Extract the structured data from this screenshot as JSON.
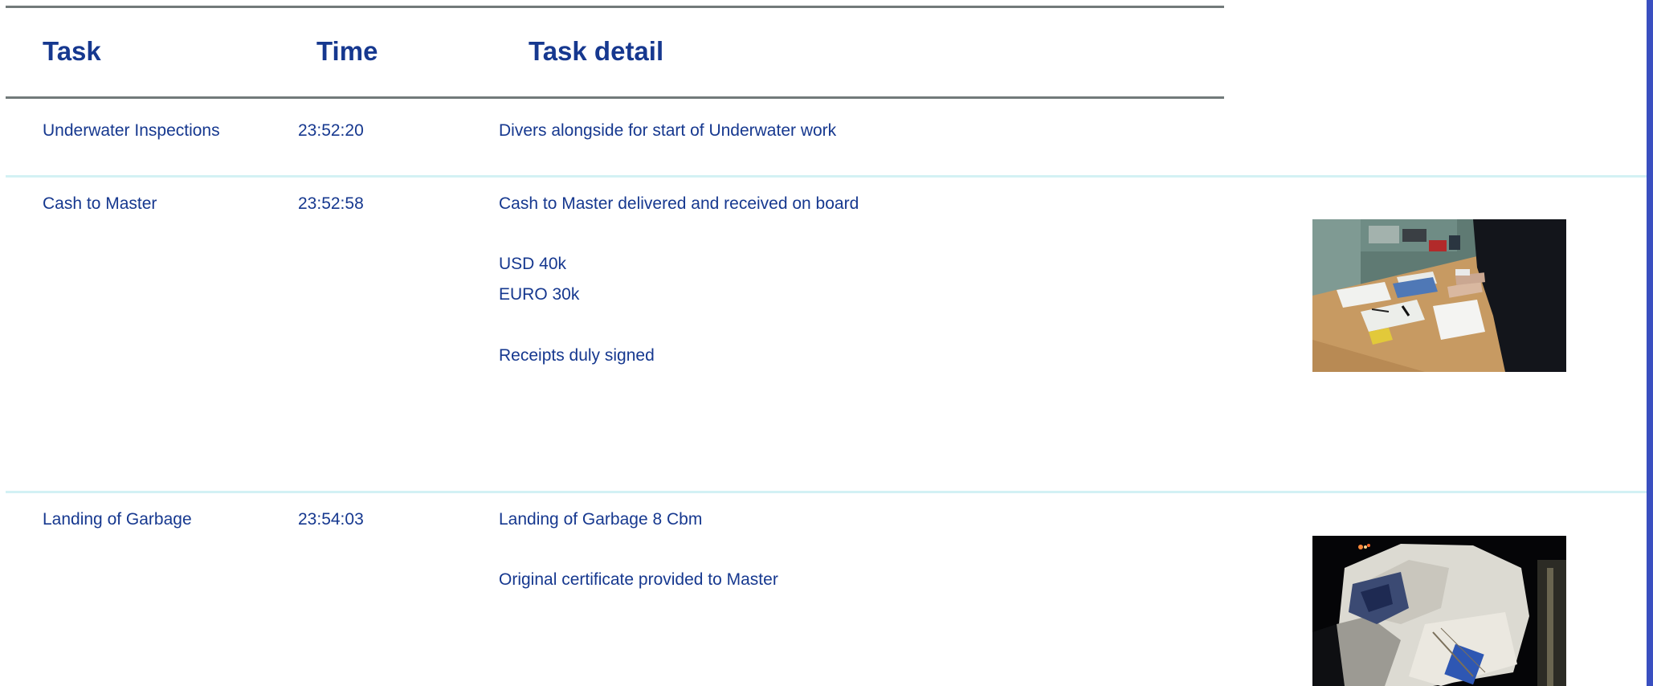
{
  "table": {
    "headers": {
      "task": "Task",
      "time": "Time",
      "detail": "Task detail"
    },
    "rows": [
      {
        "task": "Underwater Inspections",
        "time": "23:52:20",
        "detail": [
          "Divers alongside for start of Underwater work"
        ]
      },
      {
        "task": "Cash to Master",
        "time": "23:52:58",
        "detail": [
          "Cash to Master delivered and received on board",
          "USD 40k",
          "EURO 30k",
          "Receipts duly signed"
        ],
        "photo": "photo of cash being counted on a desk on board"
      },
      {
        "task": "Landing of Garbage",
        "time": "23:54:03",
        "detail": [
          "Landing of Garbage 8 Cbm",
          "Original certificate provided to Master"
        ],
        "photo": "photo of garbage bag being landed at night"
      }
    ]
  },
  "colors": {
    "text": "#16388f",
    "rule": "#727a7a",
    "row_separator": "#d3f1f4",
    "edge_bar": "#3a4fc0"
  }
}
